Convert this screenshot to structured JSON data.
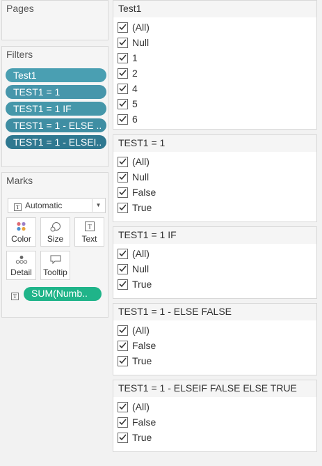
{
  "pages": {
    "title": "Pages"
  },
  "filters": {
    "title": "Filters",
    "pills": [
      "Test1",
      "TEST1 = 1",
      "TEST1 = 1  IF",
      "TEST1 = 1 - ELSE ..",
      "TEST1 = 1 - ELSEI.."
    ]
  },
  "marks": {
    "title": "Marks",
    "type_dropdown": {
      "icon": "text-mark-icon",
      "value": "Automatic"
    },
    "buttons": {
      "color": "Color",
      "size": "Size",
      "text": "Text",
      "detail": "Detail",
      "tooltip": "Tooltip"
    },
    "field_pill": "SUM(Numb..",
    "colors": {
      "pill": "#1fb489"
    }
  },
  "filter_cards": [
    {
      "title": "Test1",
      "items": [
        "(All)",
        "Null",
        "1",
        "2",
        "4",
        "5",
        "6"
      ]
    },
    {
      "title": "TEST1 = 1",
      "items": [
        "(All)",
        "Null",
        "False",
        "True"
      ]
    },
    {
      "title": "TEST1 = 1  IF",
      "items": [
        "(All)",
        "Null",
        "True"
      ]
    },
    {
      "title": "TEST1 = 1 - ELSE FALSE",
      "items": [
        "(All)",
        "False",
        "True"
      ]
    },
    {
      "title": "TEST1 = 1 - ELSEIF FALSE ELSE TRUE",
      "items": [
        "(All)",
        "False",
        "True"
      ]
    }
  ]
}
